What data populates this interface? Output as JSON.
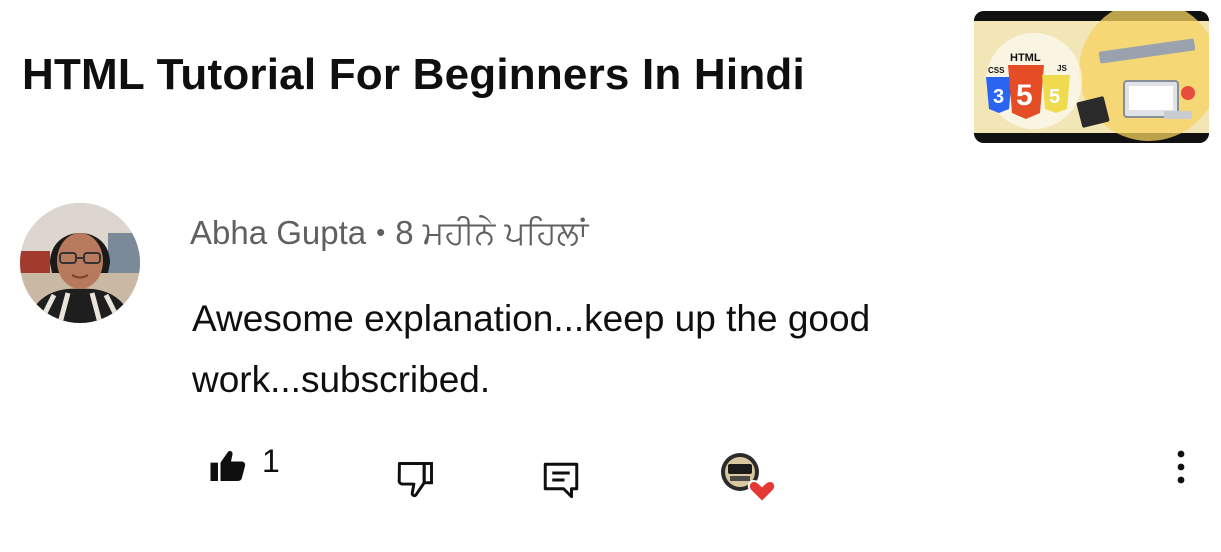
{
  "video": {
    "title": "HTML Tutorial For Beginners In Hindi",
    "thumbnail": {
      "label_html": "HTML",
      "label_css": "CSS",
      "label_js": "JS",
      "badge_css": "3",
      "badge_html": "5",
      "badge_js": "5"
    }
  },
  "comment": {
    "author": "Abha Gupta",
    "separator": "•",
    "time": "8 ਮਹੀਨੇ ਪਹਿਲਾਂ",
    "text": "Awesome explanation...keep up the good work...subscribed.",
    "like_count": "1",
    "creator_heart": true
  },
  "icons": {
    "like": "thumbs-up-filled-icon",
    "dislike": "thumbs-down-outline-icon",
    "reply": "reply-comment-icon",
    "creator_heart": "creator-heart-badge",
    "more": "more-vertical-icon"
  },
  "colors": {
    "title": "#0f0f0f",
    "meta": "#606060",
    "heart": "#e53935"
  }
}
